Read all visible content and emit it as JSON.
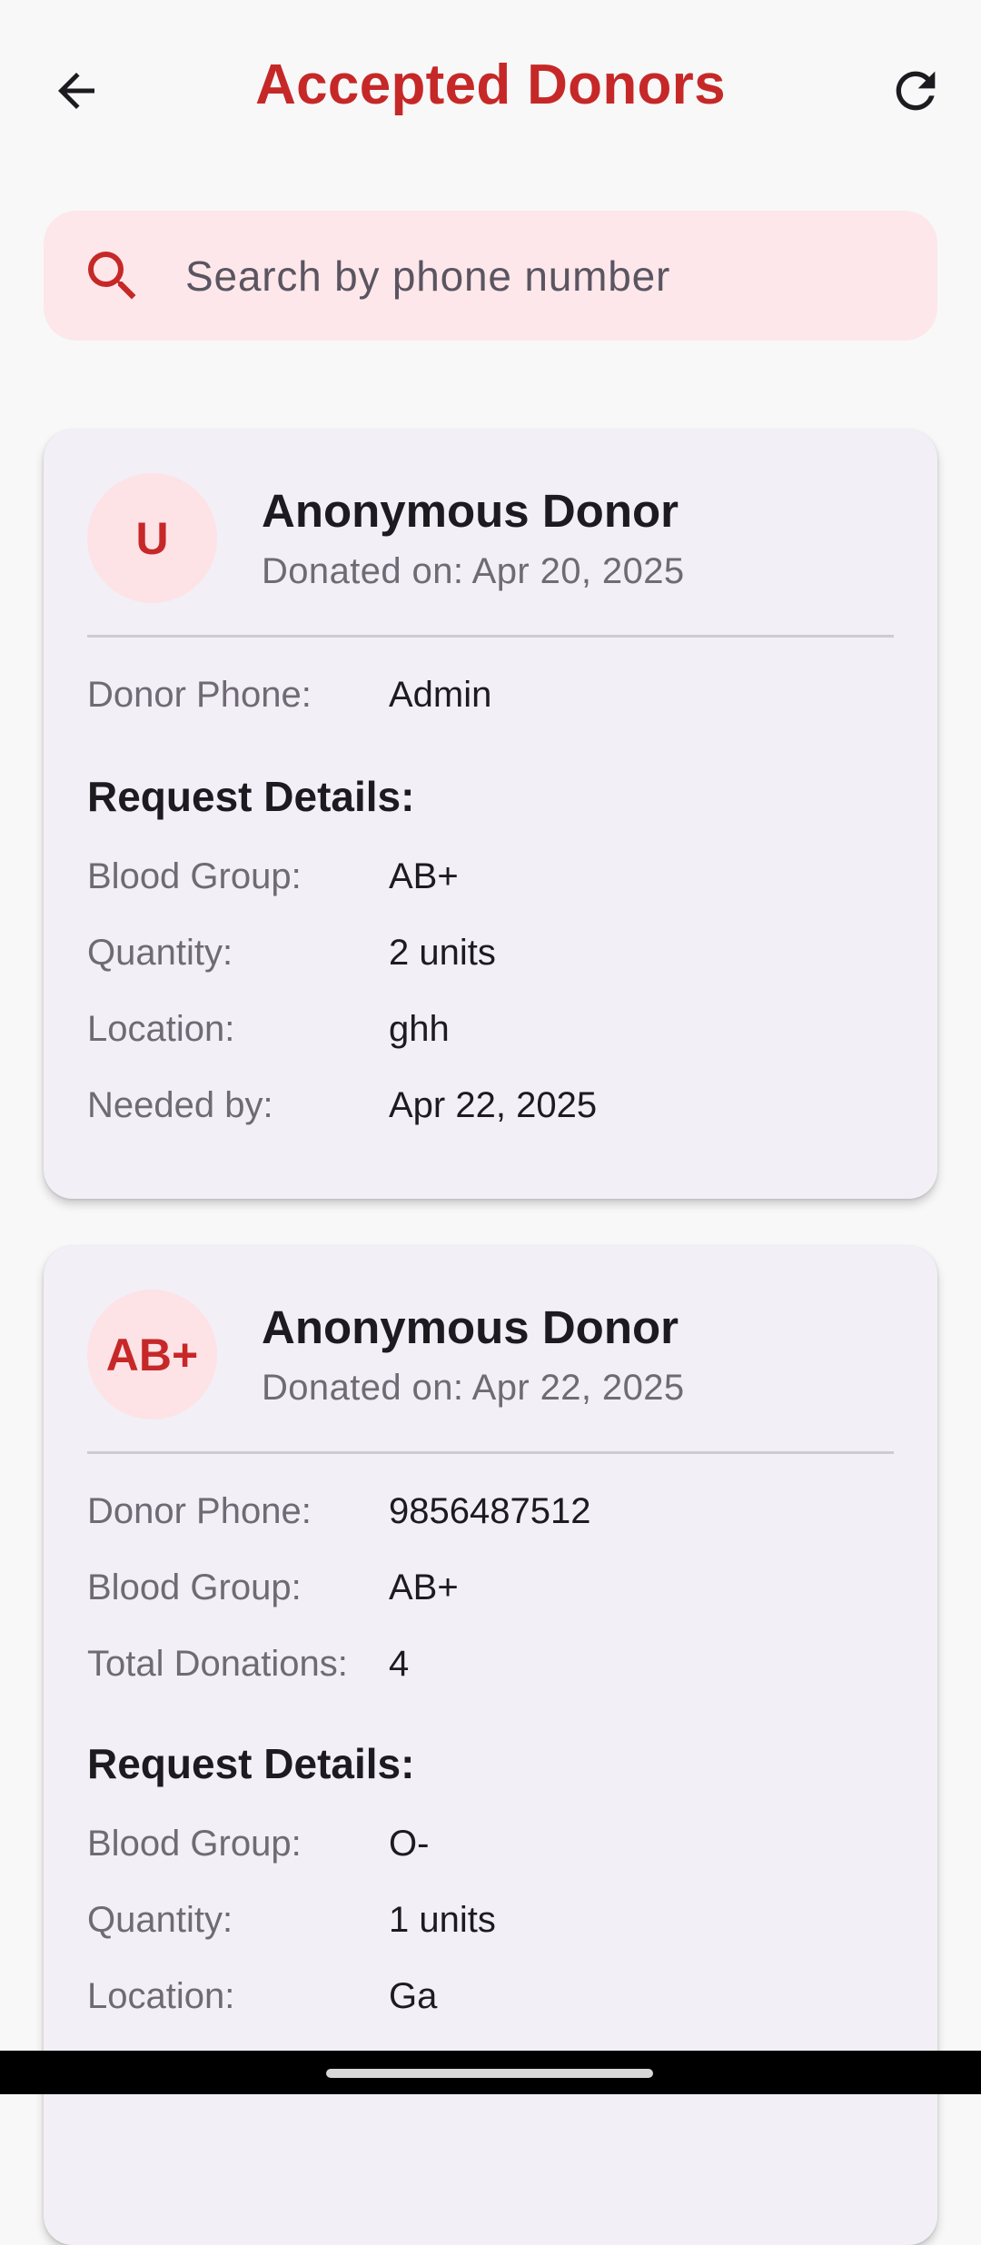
{
  "header": {
    "title": "Accepted Donors",
    "back_icon": "arrow-back-icon",
    "refresh_icon": "refresh-icon"
  },
  "search": {
    "placeholder": "Search by phone number",
    "value": "",
    "icon": "search-icon"
  },
  "colors": {
    "accent": "#c62828",
    "search_bg": "#fde7ea",
    "card_bg": "#f3eff6",
    "avatar_bg": "#fde2e6"
  },
  "donors": [
    {
      "avatar": "U",
      "name": "Anonymous Donor",
      "date": "Donated on: Apr 20, 2025",
      "donor_phone_label": "Donor Phone:",
      "donor_phone": "Admin",
      "request_title": "Request Details:",
      "request": [
        {
          "label": "Blood Group:",
          "value": "AB+"
        },
        {
          "label": "Quantity:",
          "value": "2 units"
        },
        {
          "label": "Location:",
          "value": "ghh"
        },
        {
          "label": "Needed by:",
          "value": "Apr 22, 2025"
        }
      ]
    },
    {
      "avatar": "AB+",
      "name": "Anonymous Donor",
      "date": "Donated on: Apr 22, 2025",
      "donor_phone_label": "Donor Phone:",
      "donor_phone": "9856487512",
      "blood_group_label": "Blood Group:",
      "blood_group": "AB+",
      "total_donations_label": "Total Donations:",
      "total_donations": "4",
      "request_title": "Request Details:",
      "request": [
        {
          "label": "Blood Group:",
          "value": "O-"
        },
        {
          "label": "Quantity:",
          "value": "1 units"
        },
        {
          "label": "Location:",
          "value": "Ga"
        }
      ]
    }
  ]
}
